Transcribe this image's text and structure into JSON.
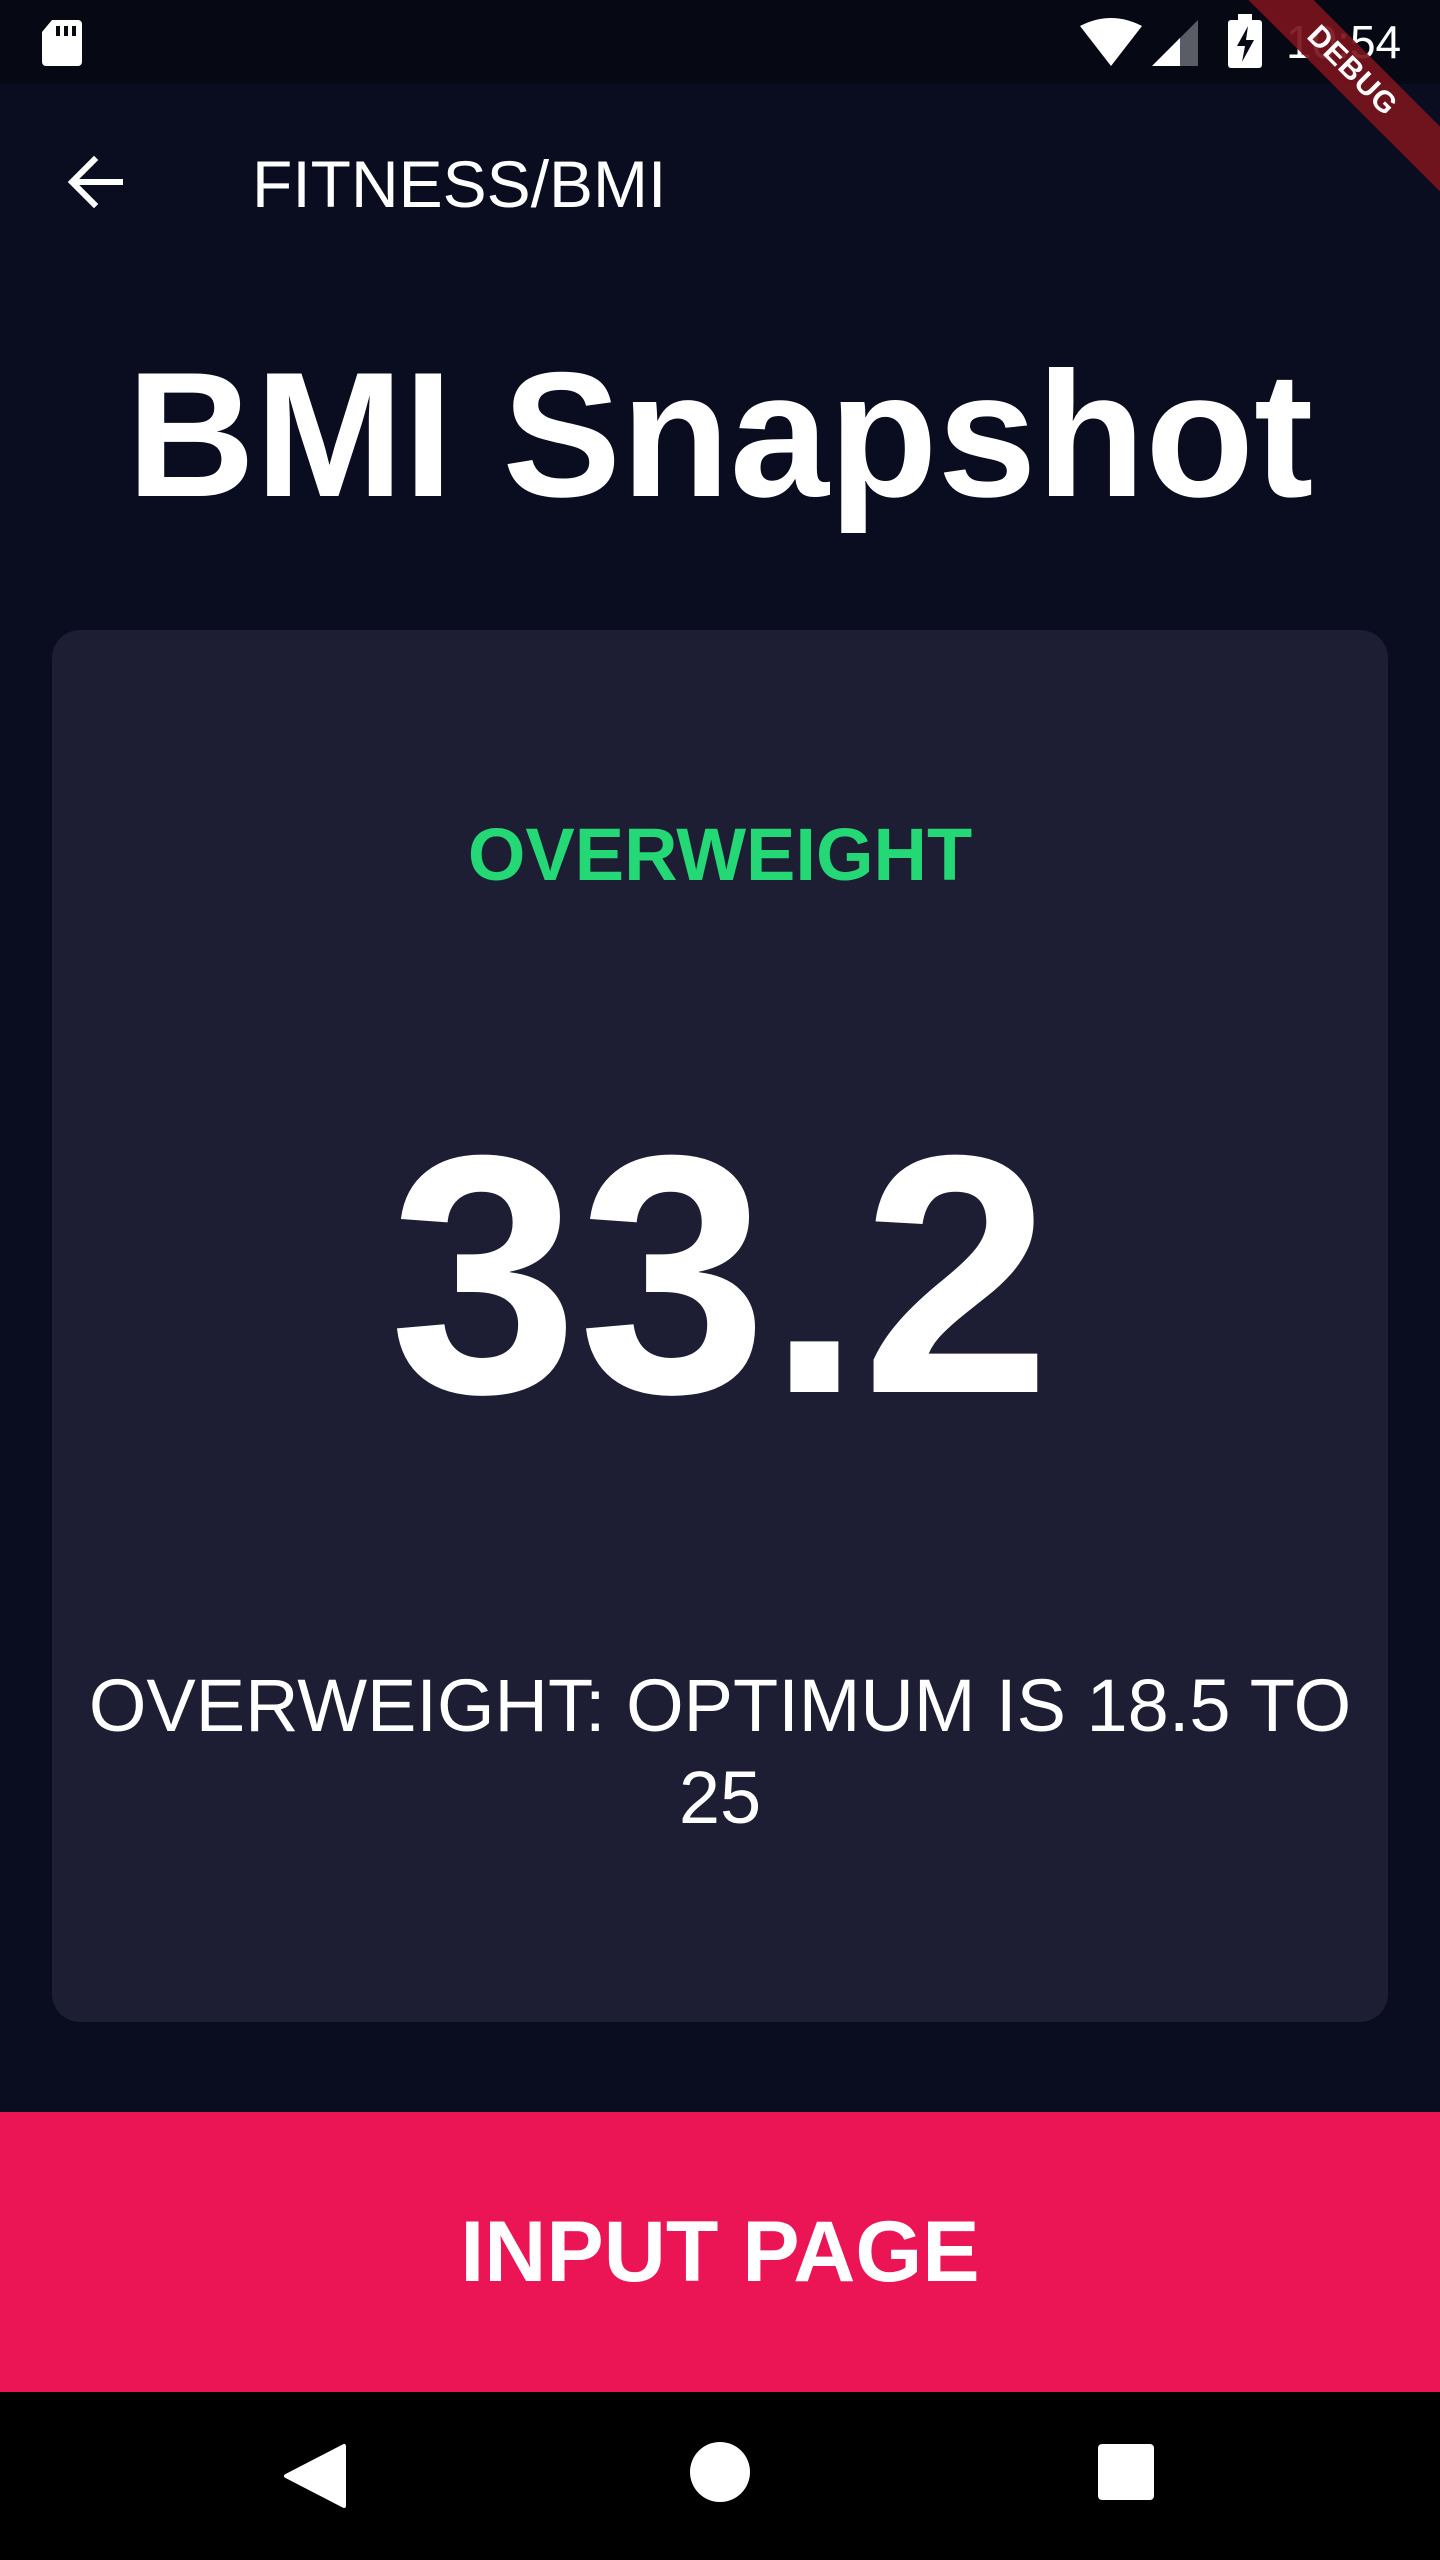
{
  "status_bar": {
    "time": "10:54",
    "icons": [
      "sd-card-icon",
      "wifi-icon",
      "cell-signal-icon",
      "battery-charging-icon"
    ]
  },
  "debug_banner": {
    "label": "DEBUG"
  },
  "app_bar": {
    "back_icon": "arrow-back-icon",
    "title": "FITNESS/BMI"
  },
  "page": {
    "title": "BMI Snapshot"
  },
  "result": {
    "status": "OVERWEIGHT",
    "bmi": "33.2",
    "message": "OVERWEIGHT:  OPTIMUM IS 18.5 TO 25"
  },
  "bottom_button": {
    "label": "INPUT PAGE"
  },
  "nav_bar": {
    "icons": [
      "nav-back-icon",
      "nav-home-icon",
      "nav-recents-icon"
    ]
  },
  "colors": {
    "background": "#090D1F",
    "card": "#1D1E33",
    "status_green": "#24D876",
    "accent_pink": "#EB1555",
    "debug_red": "#78141C"
  }
}
